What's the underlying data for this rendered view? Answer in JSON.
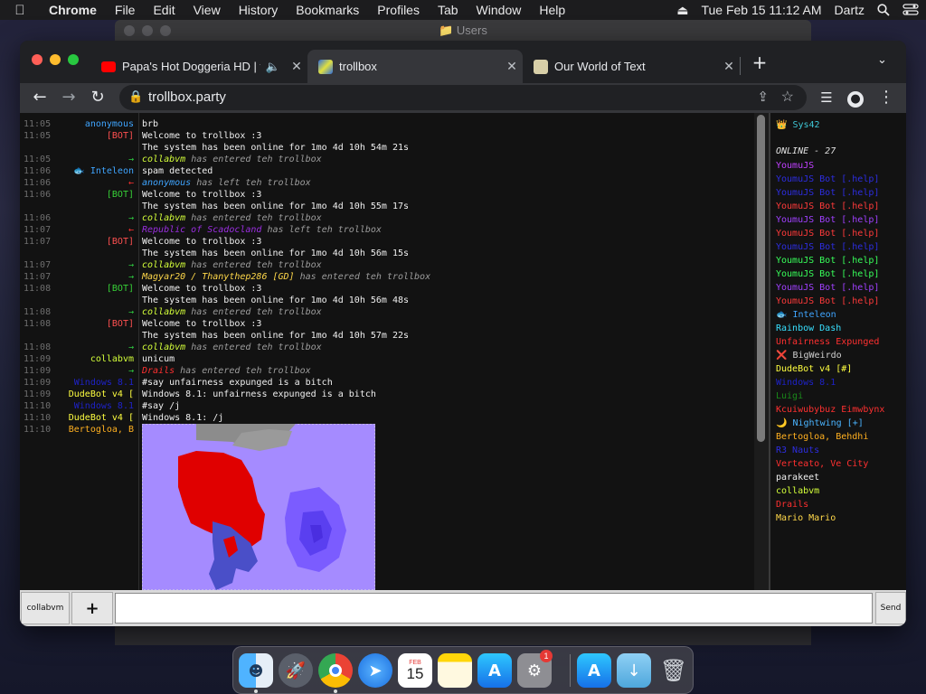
{
  "menubar": {
    "app": "Chrome",
    "items": [
      "File",
      "Edit",
      "View",
      "History",
      "Bookmarks",
      "Profiles",
      "Tab",
      "Window",
      "Help"
    ],
    "datetime": "Tue Feb 15  11:12 AM",
    "user": "Dartz"
  },
  "bg_window": {
    "title": "Users"
  },
  "browser": {
    "tabs": [
      {
        "title": "Papa's Hot Doggeria HD | f",
        "favicon": "youtube-icon",
        "active": false
      },
      {
        "title": "trollbox",
        "favicon": "trollbox-icon",
        "active": true
      },
      {
        "title": "Our World of Text",
        "favicon": "owot-icon",
        "active": false
      }
    ],
    "new_tab": "+",
    "url": "trollbox.party"
  },
  "chat": {
    "messages": [
      {
        "time": "11:05",
        "nick": "anonymous",
        "nick_color": "#3fa5ff",
        "text": "brb",
        "system": false
      },
      {
        "time": "11:05",
        "nick": "[BOT]",
        "nick_color": "#ff5050",
        "text": "Welcome to trollbox :3",
        "system": false
      },
      {
        "time": "",
        "nick": "",
        "nick_color": "#ff5050",
        "text": "The system has been online for 1mo 4d 10h 54m 21s",
        "system": false
      },
      {
        "time": "11:05",
        "nick": "→",
        "nick_color": "#2ecc40",
        "text_nick": "collabvm",
        "text_nick_color": "#d4ff3a",
        "text": "has entered teh trollbox",
        "system": true
      },
      {
        "time": "11:06",
        "nick": "🐟 Inteleon",
        "nick_color": "#3fa5ff",
        "text": "spam detected",
        "system": false
      },
      {
        "time": "11:06",
        "nick": "←",
        "nick_color": "#ff3030",
        "text_nick": "anonymous",
        "text_nick_color": "#3fa5ff",
        "text": "has left teh trollbox",
        "system": true
      },
      {
        "time": "11:06",
        "nick": "[BOT]",
        "nick_color": "#37d037",
        "text": "Welcome to trollbox :3",
        "system": false
      },
      {
        "time": "",
        "nick": "",
        "nick_color": "#37d037",
        "text": "The system has been online for 1mo 4d 10h 55m 17s",
        "system": false
      },
      {
        "time": "11:06",
        "nick": "→",
        "nick_color": "#2ecc40",
        "text_nick": "collabvm",
        "text_nick_color": "#d4ff3a",
        "text": "has entered teh trollbox",
        "system": true
      },
      {
        "time": "11:07",
        "nick": "←",
        "nick_color": "#ff3030",
        "text_nick": "Republic of Scadocland",
        "text_nick_color": "#9a2ee0",
        "text": "has left teh trollbox",
        "system": true
      },
      {
        "time": "11:07",
        "nick": "[BOT]",
        "nick_color": "#ff5050",
        "text": "Welcome to trollbox :3",
        "system": false
      },
      {
        "time": "",
        "nick": "",
        "nick_color": "#ff5050",
        "text": "The system has been online for 1mo 4d 10h 56m 15s",
        "system": false
      },
      {
        "time": "11:07",
        "nick": "→",
        "nick_color": "#2ecc40",
        "text_nick": "collabvm",
        "text_nick_color": "#d4ff3a",
        "text": "has entered teh trollbox",
        "system": true
      },
      {
        "time": "11:07",
        "nick": "→",
        "nick_color": "#2ecc40",
        "text_nick": "Magyar20 / Thanythep286 [GD]",
        "text_nick_color": "#ffd84a",
        "text": "has entered teh trollbox",
        "system": true
      },
      {
        "time": "11:08",
        "nick": "[BOT]",
        "nick_color": "#37d037",
        "text": "Welcome to trollbox :3",
        "system": false
      },
      {
        "time": "",
        "nick": "",
        "nick_color": "#37d037",
        "text": "The system has been online for 1mo 4d 10h 56m 48s",
        "system": false
      },
      {
        "time": "11:08",
        "nick": "→",
        "nick_color": "#2ecc40",
        "text_nick": "collabvm",
        "text_nick_color": "#d4ff3a",
        "text": "has entered teh trollbox",
        "system": true
      },
      {
        "time": "11:08",
        "nick": "[BOT]",
        "nick_color": "#ff5050",
        "text": "Welcome to trollbox :3",
        "system": false
      },
      {
        "time": "",
        "nick": "",
        "nick_color": "#ff5050",
        "text": "The system has been online for 1mo 4d 10h 57m 22s",
        "system": false
      },
      {
        "time": "11:08",
        "nick": "→",
        "nick_color": "#2ecc40",
        "text_nick": "collabvm",
        "text_nick_color": "#d4ff3a",
        "text": "has entered teh trollbox",
        "system": true
      },
      {
        "time": "11:09",
        "nick": "collabvm",
        "nick_color": "#d4ff3a",
        "text": "unicum",
        "system": false
      },
      {
        "time": "11:09",
        "nick": "→",
        "nick_color": "#2ecc40",
        "text_nick": "Drails",
        "text_nick_color": "#ff3030",
        "text": "has entered teh trollbox",
        "system": true
      },
      {
        "time": "11:09",
        "nick": "Windows 8.1",
        "nick_color": "#1e22c8",
        "text": "#say unfairness expunged is a bitch",
        "system": false
      },
      {
        "time": "11:09",
        "nick": "DudeBot v4 [",
        "nick_color": "#ffff40",
        "text": "Windows 8.1: unfairness expunged is a bitch",
        "system": false
      },
      {
        "time": "11:10",
        "nick": "Windows 8.1",
        "nick_color": "#1e22c8",
        "text": "#say /j",
        "system": false
      },
      {
        "time": "11:10",
        "nick": "DudeBot v4 [",
        "nick_color": "#ffff40",
        "text": "Windows 8.1: /j",
        "system": false
      },
      {
        "time": "11:10",
        "nick": "Bertogloa, B",
        "nick_color": "#ffb020",
        "text": "",
        "system": false
      }
    ]
  },
  "sidebar": {
    "me": "👑 Sys42",
    "online_label": "ONLINE - 27",
    "users": [
      {
        "name": "YoumuJS",
        "color": "#c040ff"
      },
      {
        "name": "YoumuJS Bot [.help]",
        "color": "#2d2de0"
      },
      {
        "name": "YoumuJS Bot [.help]",
        "color": "#2d2de0"
      },
      {
        "name": "YoumuJS Bot [.help]",
        "color": "#ff3a3a"
      },
      {
        "name": "YoumuJS Bot [.help]",
        "color": "#a040ff"
      },
      {
        "name": "YoumuJS Bot [.help]",
        "color": "#ff3a3a"
      },
      {
        "name": "YoumuJS Bot [.help]",
        "color": "#2d2de0"
      },
      {
        "name": "YoumuJS Bot [.help]",
        "color": "#38ff5a"
      },
      {
        "name": "YoumuJS Bot [.help]",
        "color": "#38ff5a"
      },
      {
        "name": "YoumuJS Bot [.help]",
        "color": "#a040ff"
      },
      {
        "name": "YoumuJS Bot [.help]",
        "color": "#ff3a3a"
      },
      {
        "name": "🐟 Inteleon",
        "color": "#3fa5ff"
      },
      {
        "name": "Rainbow Dash",
        "color": "#38e0ff"
      },
      {
        "name": "Unfairness Expunged",
        "color": "#ff3030"
      },
      {
        "name": "❌ BigWeirdo",
        "color": "#cfcfcf"
      },
      {
        "name": "DudeBot v4 [#]",
        "color": "#ffff40"
      },
      {
        "name": "Windows 8.1",
        "color": "#1e22c8"
      },
      {
        "name": "Luigi",
        "color": "#1a8a1a"
      },
      {
        "name": "Kcuiwubybuz Eimwbynx",
        "color": "#ff3030"
      },
      {
        "name": "🌙 Nightwing [+]",
        "color": "#4ab4ff"
      },
      {
        "name": "Bertogloa, Behdhi",
        "color": "#ffb020"
      },
      {
        "name": "R3 Nauts",
        "color": "#2d2de0"
      },
      {
        "name": "Verteato, Ve City",
        "color": "#ff3030"
      },
      {
        "name": "parakeet",
        "color": "#f0f0f0"
      },
      {
        "name": "collabvm",
        "color": "#d4ff3a"
      },
      {
        "name": "Drails",
        "color": "#ff3030"
      },
      {
        "name": "Mario Mario",
        "color": "#ffd84a"
      }
    ]
  },
  "inputbar": {
    "nick": "collabvm",
    "plus": "+",
    "send": "Send"
  },
  "colors": {
    "chrome_bg": "#202124",
    "chrome_active_tab": "#35363a",
    "chat_bg": "#121212",
    "drawing_bg": "#a58bff",
    "drawing_red": "#e00000",
    "drawing_purple": "#6a4cff"
  },
  "dock": {
    "apps": [
      "finder-icon",
      "launchpad-icon",
      "chrome-icon",
      "safari-icon",
      "calendar-icon",
      "notes-icon",
      "app-store-icon",
      "system-preferences-icon",
      "app-store-icon",
      "downloads-folder-icon",
      "trash-icon"
    ],
    "calendar_day": "15",
    "calendar_month": "FEB",
    "badge": "1"
  }
}
